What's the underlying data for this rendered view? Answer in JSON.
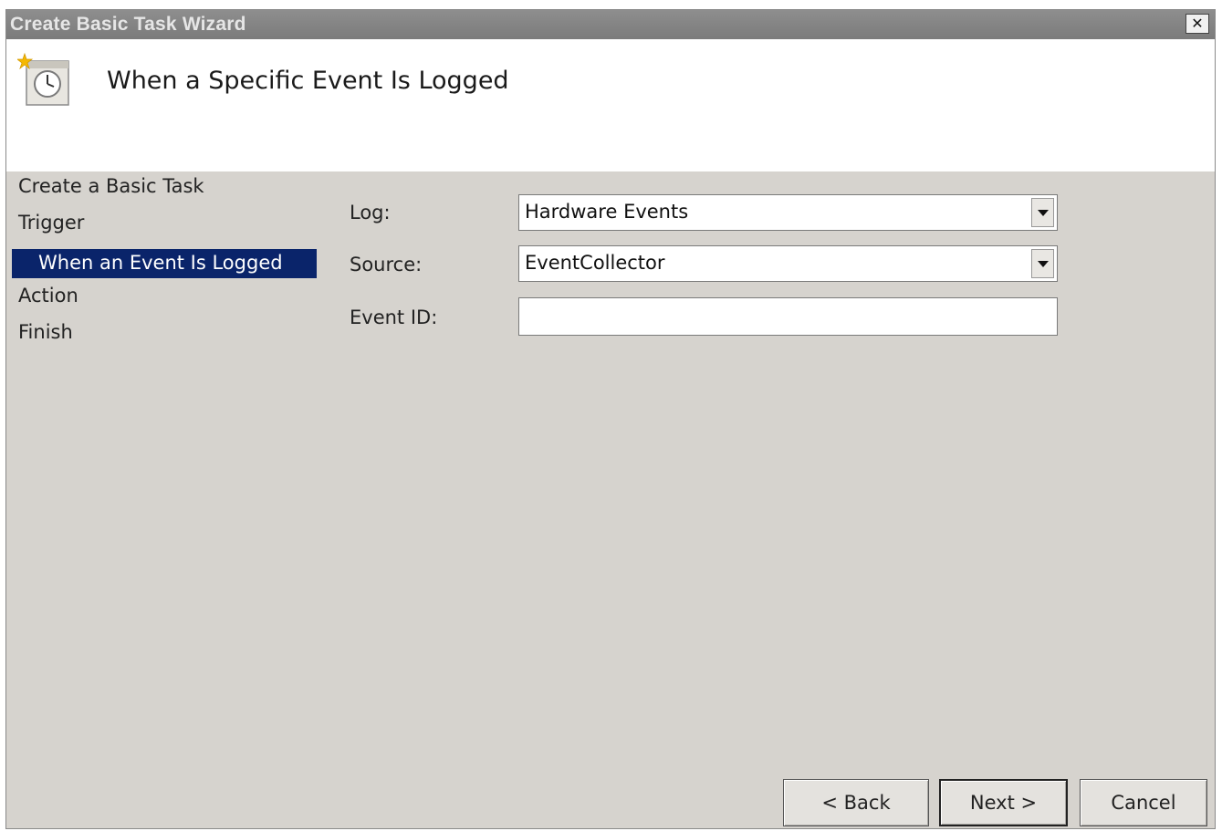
{
  "window": {
    "title": "Create Basic Task Wizard",
    "close_glyph": "✕"
  },
  "header": {
    "title": "When a Specific Event Is Logged",
    "icon": "task-scheduler-clock-icon"
  },
  "steps": [
    {
      "label": "Create a Basic Task",
      "active": false
    },
    {
      "label": "Trigger",
      "active": false
    },
    {
      "label": "When an Event Is Logged",
      "active": true
    },
    {
      "label": "Action",
      "active": false
    },
    {
      "label": "Finish",
      "active": false
    }
  ],
  "form": {
    "log": {
      "label": "Log:",
      "value": "Hardware Events"
    },
    "source": {
      "label": "Source:",
      "value": "EventCollector"
    },
    "event_id": {
      "label": "Event ID:",
      "value": ""
    }
  },
  "buttons": {
    "back": "< Back",
    "next": "Next >",
    "cancel": "Cancel"
  },
  "colors": {
    "selection": "#0a246a",
    "dialog_bg": "#d6d3ce",
    "titlebar": "#7f7f7f"
  }
}
